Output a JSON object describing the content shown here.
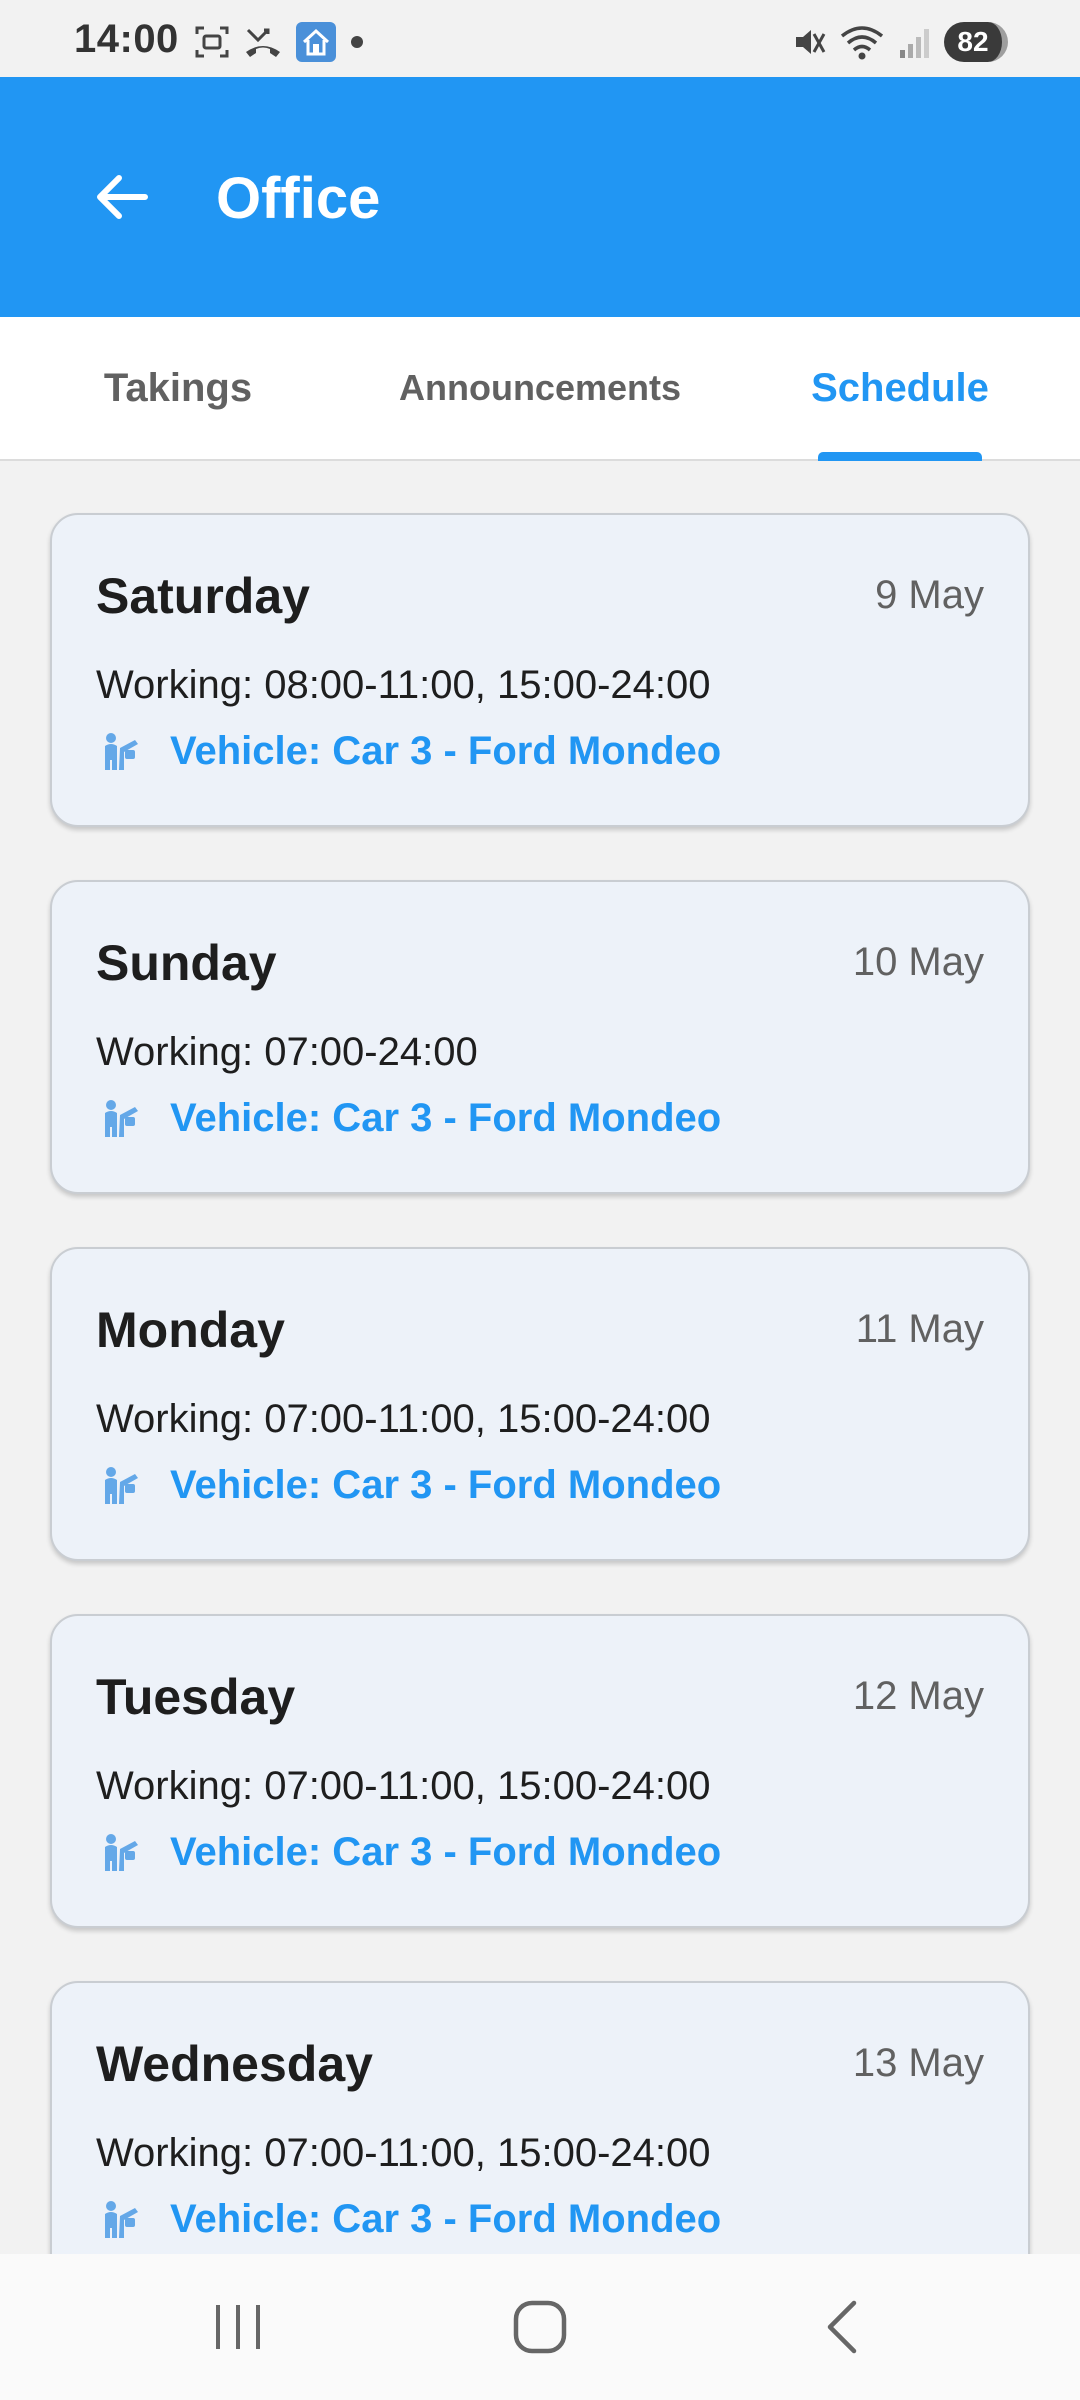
{
  "status_bar": {
    "time": "14:00",
    "battery": "82",
    "left_icons": [
      "screenshot-icon",
      "missed-call-icon",
      "home-app-icon",
      "dot-icon"
    ],
    "right_icons": [
      "mute-icon",
      "wifi-icon",
      "signal-icon"
    ]
  },
  "app_bar": {
    "title": "Office",
    "back_icon": "arrow-left-icon",
    "color": "#2196f3"
  },
  "tabs": [
    {
      "label": "Takings",
      "active": false
    },
    {
      "label": "Announcements",
      "active": false
    },
    {
      "label": "Schedule",
      "active": true
    }
  ],
  "schedule": [
    {
      "day": "Saturday",
      "date": "9 May",
      "working": "Working: 08:00-11:00, 15:00-24:00",
      "vehicle": "Vehicle: Car 3 - Ford Mondeo"
    },
    {
      "day": "Sunday",
      "date": "10 May",
      "working": "Working: 07:00-24:00",
      "vehicle": "Vehicle: Car 3 - Ford Mondeo"
    },
    {
      "day": "Monday",
      "date": "11 May",
      "working": "Working: 07:00-11:00, 15:00-24:00",
      "vehicle": "Vehicle: Car 3 - Ford Mondeo"
    },
    {
      "day": "Tuesday",
      "date": "12 May",
      "working": "Working: 07:00-11:00, 15:00-24:00",
      "vehicle": "Vehicle: Car 3 - Ford Mondeo"
    },
    {
      "day": "Wednesday",
      "date": "13 May",
      "working": "Working: 07:00-11:00, 15:00-24:00",
      "vehicle": "Vehicle: Car 3 - Ford Mondeo"
    }
  ],
  "nav_bar": {
    "icons": [
      "recent-apps-icon",
      "home-icon",
      "back-icon"
    ]
  }
}
